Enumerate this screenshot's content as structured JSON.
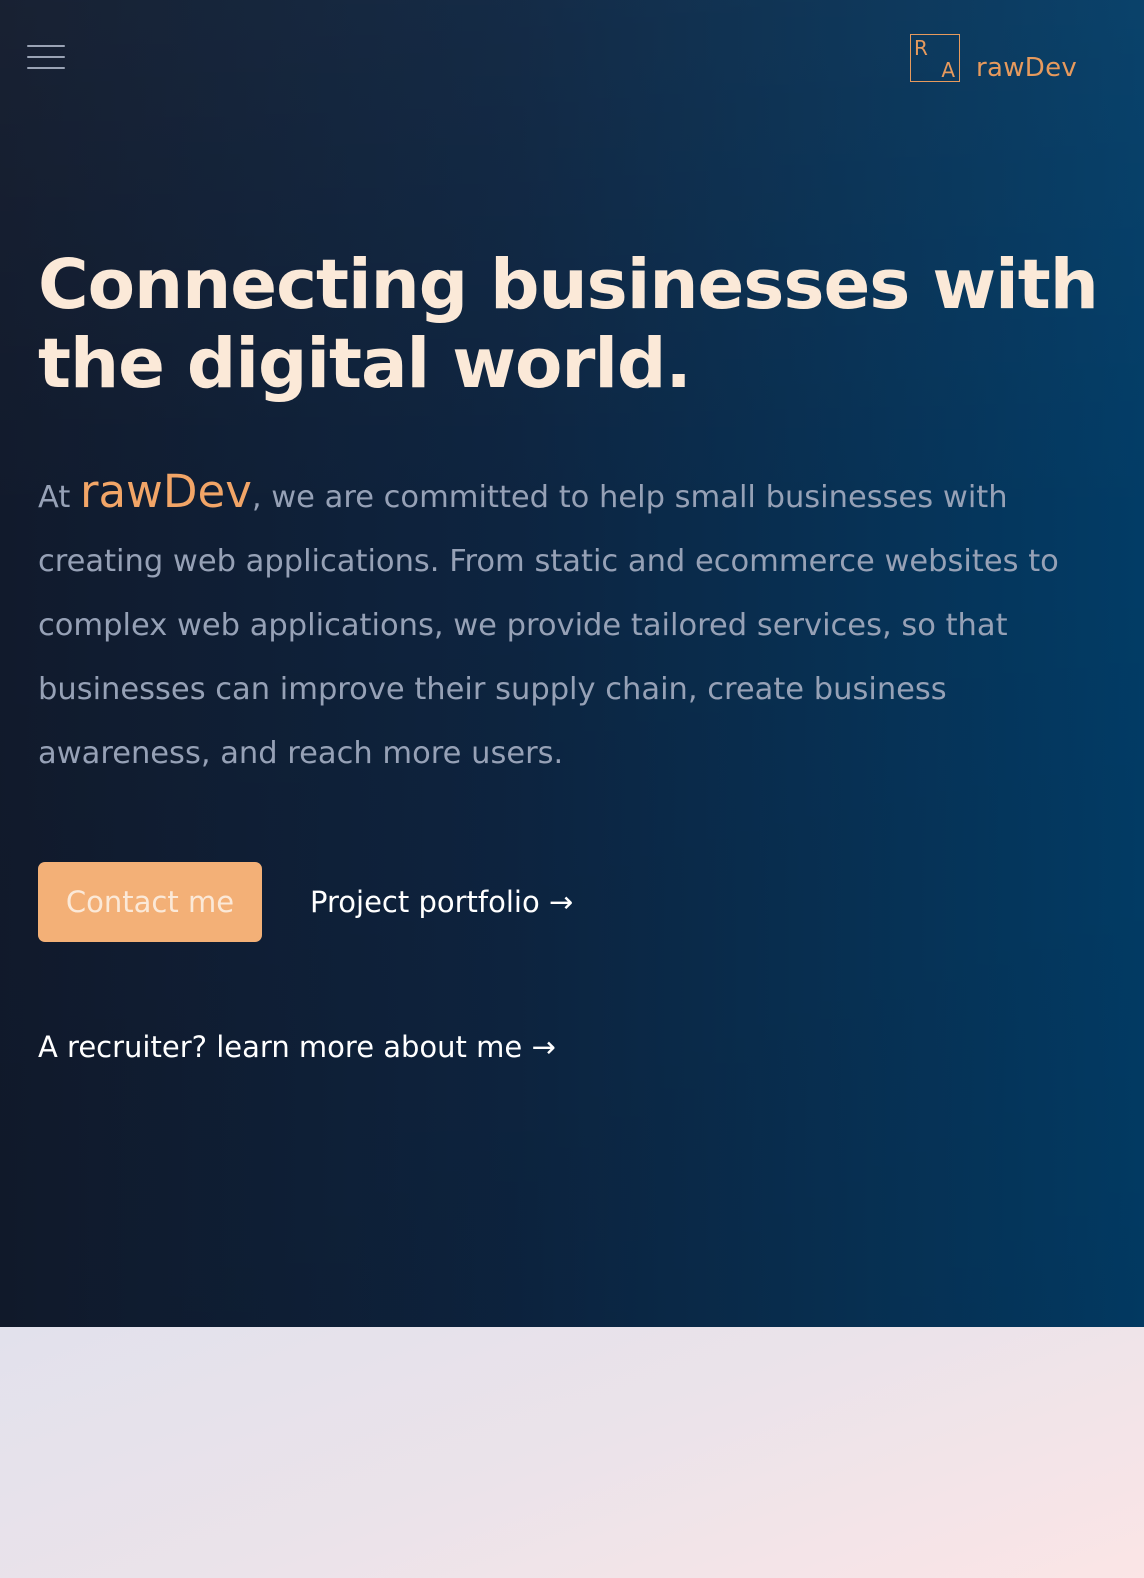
{
  "header": {
    "menu_icon": "hamburger-menu-icon",
    "logo": {
      "letter_top": "R",
      "letter_bottom": "A"
    },
    "brand_name": "rawDev"
  },
  "hero": {
    "headline": "Connecting businesses with the digital world.",
    "intro_prefix": "At ",
    "intro_brand": "rawDev",
    "intro_body": ", we are committed to help small businesses with creating web applications. From static and ecommerce websites to complex web applications, we provide tailored services, so that businesses can improve their supply chain, create business awareness, and reach more users.",
    "contact_label": "Contact me",
    "portfolio_label": "Project portfolio →",
    "recruiter_label": "A recruiter? learn more about me →"
  },
  "colors": {
    "accent": "#f2a567",
    "button_bg": "#f3b077",
    "headline": "#fbe9d8",
    "body_text": "#96a1b6",
    "hero_bg_left": "#111a2c",
    "hero_bg_right": "#023c66"
  }
}
